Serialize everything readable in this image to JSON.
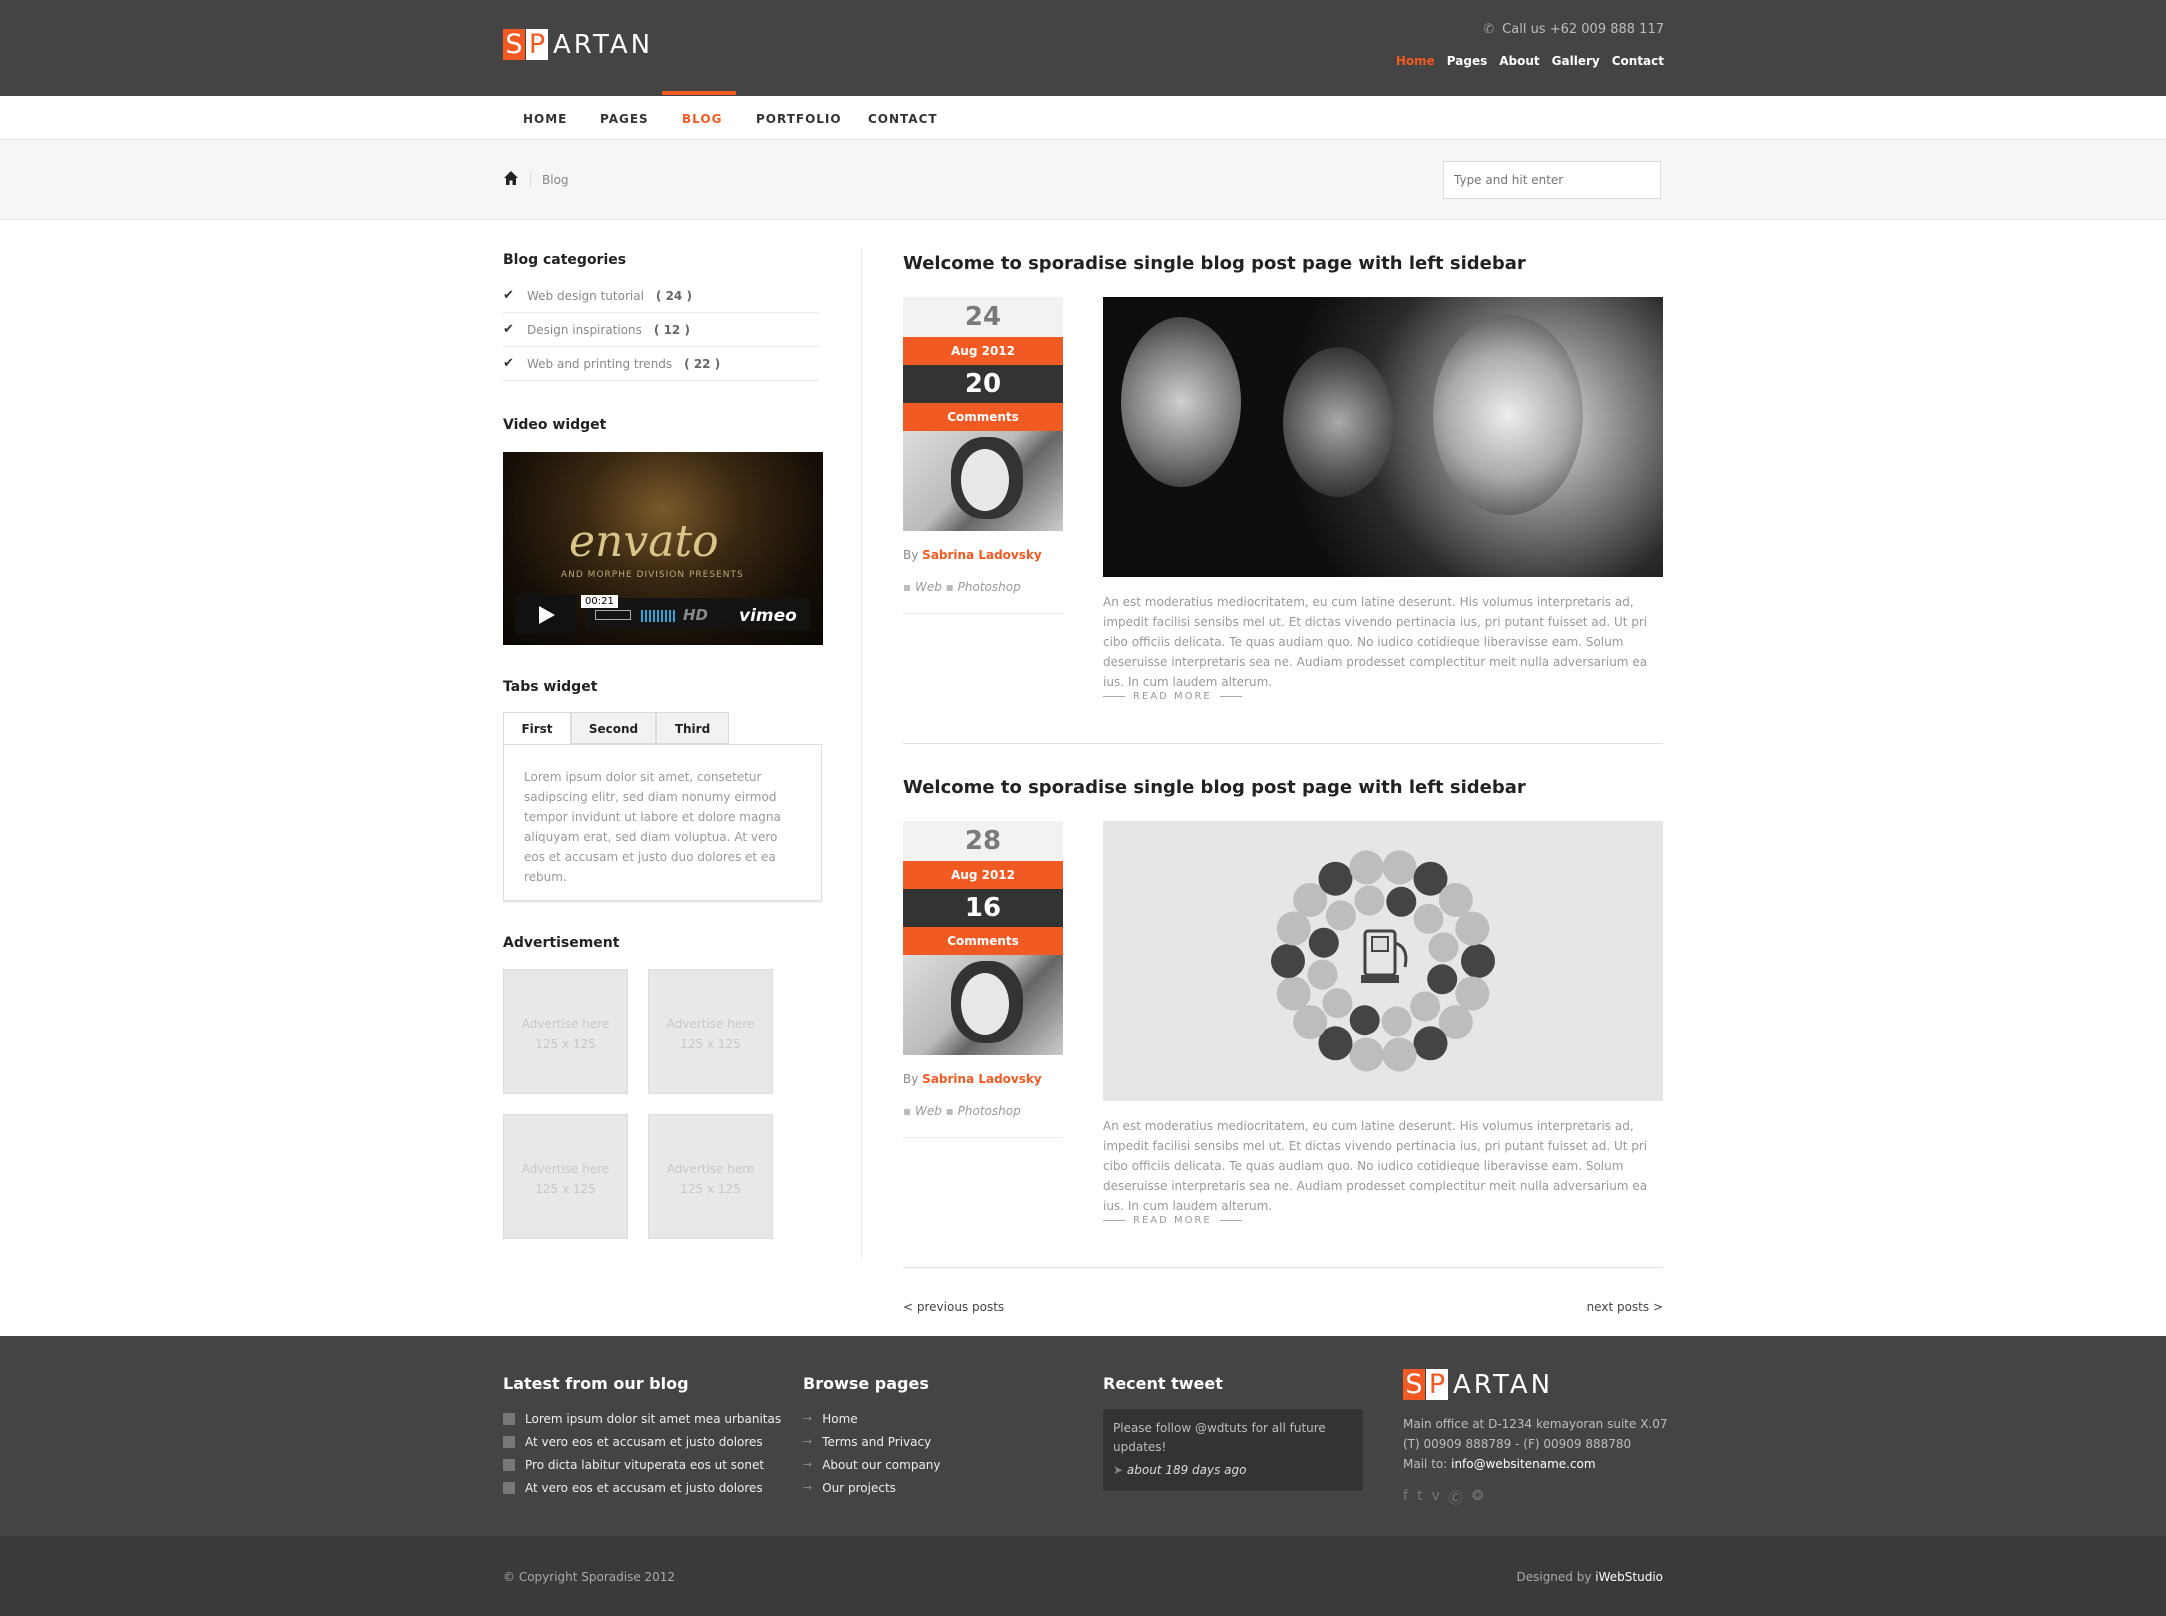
{
  "brand": {
    "logo_s": "S",
    "logo_p": "P",
    "logo_rest": "ARTAN"
  },
  "header": {
    "phone": "Call us +62 009 888 117",
    "top_links": [
      "Home",
      "Pages",
      "About",
      "Gallery",
      "Contact"
    ]
  },
  "nav": {
    "items": [
      "HOME",
      "PAGES",
      "BLOG",
      "PORTFOLIO",
      "CONTACT"
    ],
    "active": "BLOG"
  },
  "breadcrumb": {
    "current": "Blog"
  },
  "search": {
    "placeholder": "Type and hit enter"
  },
  "sidebar": {
    "categories_title": "Blog categories",
    "categories": [
      {
        "label": "Web design tutorial",
        "count": "( 24 )"
      },
      {
        "label": "Design inspirations",
        "count": "( 12 )"
      },
      {
        "label": "Web and printing trends",
        "count": "( 22 )"
      }
    ],
    "video_title": "Video widget",
    "video": {
      "title": "envato",
      "subtitle": "AND MORPHE DIVISION PRESENTS",
      "time": "00:21",
      "hd": "HD",
      "provider": "vimeo"
    },
    "tabs_title": "Tabs widget",
    "tabs": [
      "First",
      "Second",
      "Third"
    ],
    "tab_content": "Lorem ipsum dolor sit amet, consetetur sadipscing elitr, sed diam nonumy eirmod tempor invidunt ut labore et dolore magna aliquyam erat, sed diam voluptua. At vero eos et accusam et justo duo dolores et ea rebum.",
    "ads_title": "Advertisement",
    "ad_text": "Advertise here",
    "ad_size": "125 x 125"
  },
  "posts": [
    {
      "title": "Welcome to sporadise single blog post page with left sidebar",
      "day": "24",
      "month": "Aug 2012",
      "comments_count": "20",
      "comments_label": "Comments",
      "by": "By",
      "author": "Sabrina Ladovsky",
      "tags": [
        "Web",
        "Photoshop"
      ],
      "excerpt": "An est moderatius mediocritatem, eu cum latine deserunt. His volumus interpretaris ad, impedit facilisi sensibs mel ut. Et dictas vivendo pertinacia ius, pri putant fuisset ad. Ut pri cibo officiis delicata. Te quas audiam quo. No iudico cotidieque liberavisse eam. Solum deseruisse interpretaris sea ne. Audiam prodesset complectitur meit nulla adversarium ea ius. In cum laudem alterum.",
      "read_more": "READ MORE"
    },
    {
      "title": "Welcome to sporadise single blog post page with left sidebar",
      "day": "28",
      "month": "Aug 2012",
      "comments_count": "16",
      "comments_label": "Comments",
      "by": "By",
      "author": "Sabrina Ladovsky",
      "tags": [
        "Web",
        "Photoshop"
      ],
      "excerpt": "An est moderatius mediocritatem, eu cum latine deserunt. His volumus interpretaris ad, impedit facilisi sensibs mel ut. Et dictas vivendo pertinacia ius, pri putant fuisset ad. Ut pri cibo officiis delicata. Te quas audiam quo. No iudico cotidieque liberavisse eam. Solum deseruisse interpretaris sea ne. Audiam prodesset complectitur meit nulla adversarium ea ius. In cum laudem alterum.",
      "read_more": "READ MORE"
    }
  ],
  "pagination": {
    "prev": "< previous posts",
    "next": "next posts >"
  },
  "footer": {
    "blog_title": "Latest from our blog",
    "blog_items": [
      "Lorem ipsum dolor sit amet mea urbanitas",
      "At vero eos et accusam et justo dolores",
      "Pro dicta labitur vituperata eos ut sonet",
      "At vero eos et accusam et justo dolores"
    ],
    "pages_title": "Browse pages",
    "pages_items": [
      "Home",
      "Terms and Privacy",
      "About our company",
      "Our projects"
    ],
    "tweet_title": "Recent tweet",
    "tweet_text": "Please follow @wdtuts for all future updates!",
    "tweet_time": "about 189 days ago",
    "office": "Main office at D-1234 kemayoran suite X.07",
    "phones": "(T) 00909 888789 - (F) 00909 888780",
    "mail_label": "Mail to:",
    "mail": "info@websitename.com",
    "copyright": "© Copyright Sporadise 2012",
    "designed_by": "Designed by",
    "designer": "iWebStudio"
  },
  "colors": {
    "accent": "#f15a22",
    "header_bg": "#444444",
    "footer_bg": "#444444"
  }
}
